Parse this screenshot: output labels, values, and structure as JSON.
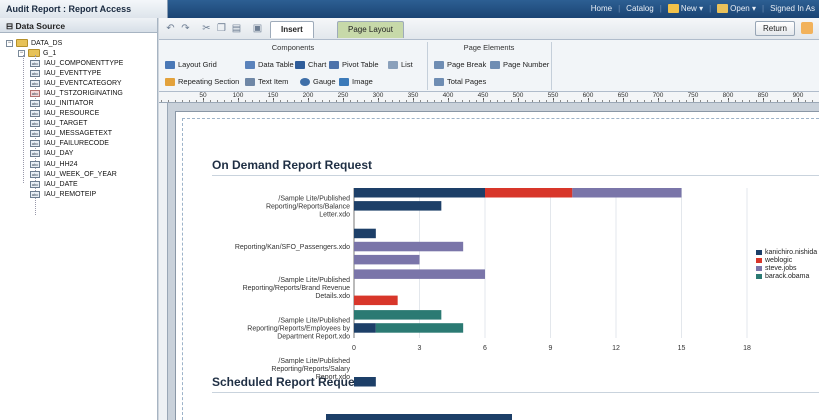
{
  "app": {
    "title": "Audit Report : Report Access",
    "nav": [
      "Home",
      "Catalog",
      "New",
      "Open",
      "Signed In As"
    ]
  },
  "left_pane": {
    "header": "Data Source",
    "root": "DATA_DS",
    "group": "G_1",
    "fields": [
      "IAU_COMPONENTTYPE",
      "IAU_EVENTTYPE",
      "IAU_EVENTCATEGORY",
      "IAU_TSTZORIGINATING",
      "IAU_INITIATOR",
      "IAU_RESOURCE",
      "IAU_TARGET",
      "IAU_MESSAGETEXT",
      "IAU_FAILURECODE",
      "IAU_DAY",
      "IAU_HH24",
      "IAU_WEEK_OF_YEAR",
      "IAU_DATE",
      "IAU_REMOTEIP"
    ]
  },
  "toolbar": {
    "tab_insert": "Insert",
    "tab_page_layout": "Page Layout",
    "return_label": "Return"
  },
  "ribbon": {
    "components_title": "Components",
    "page_elements_title": "Page Elements",
    "layout_grid": "Layout Grid",
    "data_table": "Data Table",
    "chart": "Chart",
    "pivot_table": "Pivot Table",
    "list": "List",
    "repeating_section": "Repeating Section",
    "text_item": "Text Item",
    "gauge": "Gauge",
    "image": "Image",
    "page_break": "Page Break",
    "page_number": "Page Number",
    "total_pages": "Total Pages"
  },
  "ruler": {
    "labels": [
      "50",
      "100",
      "150",
      "200",
      "250",
      "300",
      "350",
      "400",
      "450",
      "500",
      "550",
      "600",
      "650",
      "700",
      "750",
      "800",
      "850",
      "900",
      "9"
    ]
  },
  "page": {
    "section1_title": "On Demand Report Request",
    "section2_title": "Scheduled Report Request",
    "section2_first_label": "/Sample Lite/Published"
  },
  "chart_data": {
    "type": "bar",
    "orientation": "horizontal",
    "stacked": true,
    "categories": [
      "/Sample Lite/Published Reporting/Reports/Balance Letter.xdo",
      "/Sample Lite/Published Reporting/Kan/SFO_Passengers.xdo",
      "/Sample Lite/Published Reporting/Reports/Brand Revenue Details.xdo",
      "/Sample Lite/Published Reporting/Reports/Employees by Department Report.xdo",
      "/Sample Lite/Published Reporting/Reports/Salary Report.xdo"
    ],
    "category_label_lines": [
      [
        "/Sample Lite/Published",
        "Reporting/Reports/Balance",
        "Letter.xdo"
      ],
      [
        "Reporting/Kan/SFO_Passengers.xdo"
      ],
      [
        "/Sample Lite/Published",
        "Reporting/Reports/Brand Revenue",
        "Details.xdo"
      ],
      [
        "/Sample Lite/Published",
        "Reporting/Reports/Employees by",
        "Department Report.xdo"
      ],
      [
        "/Sample Lite/Published",
        "Reporting/Reports/Salary",
        "Report.xdo"
      ]
    ],
    "bars_per_category": 3,
    "series": [
      {
        "name": "kanichiro.nishida",
        "color": "#1d3f68",
        "values": [
          [
            6,
            4,
            0
          ],
          [
            1,
            0,
            0
          ],
          [
            0,
            0,
            0
          ],
          [
            0,
            1,
            0
          ],
          [
            0,
            0,
            1
          ]
        ]
      },
      {
        "name": "weblogic",
        "color": "#d8362a",
        "values": [
          [
            4,
            0,
            0
          ],
          [
            0,
            0,
            0
          ],
          [
            0,
            0,
            2
          ],
          [
            0,
            0,
            0
          ],
          [
            0,
            0,
            0
          ]
        ]
      },
      {
        "name": "steve.jobs",
        "color": "#7a75a9",
        "values": [
          [
            5,
            0,
            0
          ],
          [
            0,
            5,
            3
          ],
          [
            6,
            0,
            0
          ],
          [
            0,
            0,
            0
          ],
          [
            0,
            0,
            0
          ]
        ]
      },
      {
        "name": "barack.obama",
        "color": "#2b7a73",
        "values": [
          [
            0,
            0,
            0
          ],
          [
            0,
            0,
            0
          ],
          [
            0,
            0,
            0
          ],
          [
            4,
            4,
            0
          ],
          [
            0,
            0,
            0
          ]
        ]
      }
    ],
    "x_ticks": [
      0,
      3,
      6,
      9,
      12,
      15,
      18
    ],
    "xlim": [
      0,
      18
    ],
    "legend_position": "right"
  }
}
